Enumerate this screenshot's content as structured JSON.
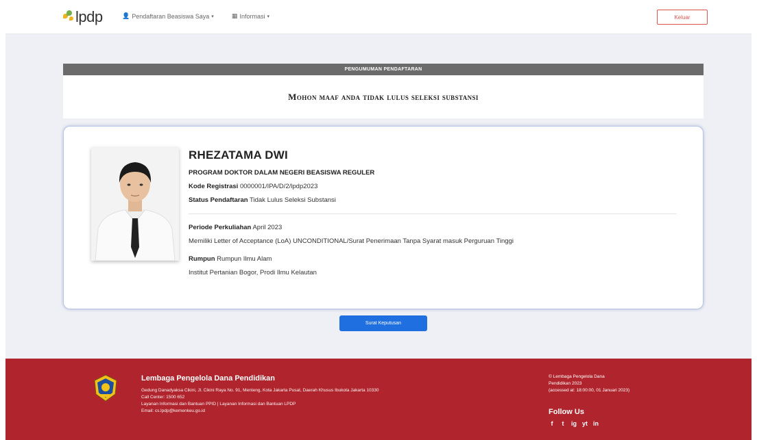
{
  "navbar": {
    "brand": "lpdp",
    "user_menu": "Pendaftaran Beasiswa Saya",
    "info_menu": "Informasi",
    "logout_label": "Keluar"
  },
  "announcement": {
    "header": "PENGUMUMAN PENDAFTARAN",
    "message": "Mohon maaf anda tidak lulus seleksi substansi"
  },
  "profile": {
    "name": "RHEZATAMA DWI",
    "program": "PROGRAM DOKTOR DALAM NEGERI BEASISWA REGULER",
    "reg_label": "Kode Registrasi",
    "reg_value": "0000001/IPA/D/2/lpdp2023",
    "status_label": "Status Pendaftaran",
    "status_value": "Tidak Lulus Seleksi Substansi",
    "period_label": "Periode Perkuliahan",
    "period_value": "April 2023",
    "loa": "Memiliki Letter of Acceptance (LoA) UNCONDITIONAL/Surat Penerimaan Tanpa Syarat masuk Perguruan Tinggi",
    "cluster_label": "Rumpun",
    "cluster_value": "Rumpun Ilmu Alam",
    "university": "Institut Pertanian Bogor, Prodi Ilmu Kelautan"
  },
  "action": {
    "button_label": "Surat Keputusan"
  },
  "footer": {
    "org_name": "Lembaga Pengelola Dana Pendidikan",
    "address": "Gedung Danadyaksa Cikini, Jl. Cikini Raya No. 91, Menteng, Kota Jakarta Pusat, Daerah Khusus Ibukota Jakarta 10330",
    "call_center": "Call Center: 1500 652",
    "help": "Layanan Informasi dan Bantuan PPID | Layanan Informasi dan Bantuan LPDP",
    "email": "Email: cs.lpdp@kemenkeu.go.id",
    "copyright": "© Lembaga Pengelola Dana",
    "copyright2": "Pendidikan 2023",
    "accessed": "(accessed at: 18:00:00, 01 Januari 2023)",
    "follow_label": "Follow Us",
    "socials": [
      "f",
      "t",
      "ig",
      "yt",
      "in"
    ],
    "accent": "#b0252d"
  }
}
